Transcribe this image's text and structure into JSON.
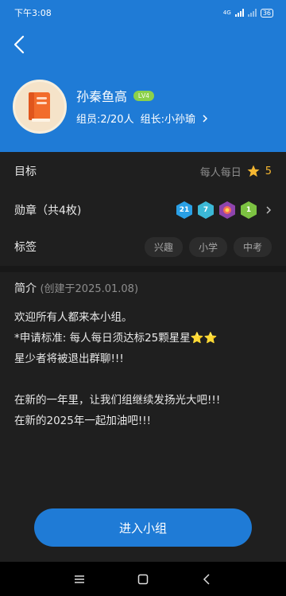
{
  "status_bar": {
    "time": "下午3:08",
    "network": "4G",
    "battery": "36"
  },
  "group": {
    "name": "孙秦鱼高",
    "level": "LV4",
    "members": "组员:2/20人",
    "leader": "组长:小孙瑜"
  },
  "goal": {
    "label": "目标",
    "value": "每人每日",
    "star_count": "5"
  },
  "medals": {
    "label": "勋章（共4枚)",
    "items": [
      {
        "text": "21",
        "color": "#2aa0e6"
      },
      {
        "text": "7",
        "color": "#3bb8d6"
      },
      {
        "text": "",
        "color": "#8e44ad"
      },
      {
        "text": "1",
        "color": "#7cc242"
      }
    ]
  },
  "tags": {
    "label": "标签",
    "items": [
      "兴趣",
      "小学",
      "中考"
    ]
  },
  "intro": {
    "title": "简介",
    "created": "(创建于2025.01.08)",
    "lines": [
      "欢迎所有人都来本小组。",
      "*申请标准: 每人每日须达标25颗星星⭐⭐",
      "星少者将被退出群聊!!!",
      "",
      "在新的一年里，让我们组继续发扬光大吧!!!",
      "在新的2025年一起加油吧!!!"
    ]
  },
  "join_button": "进入小组",
  "colors": {
    "primary": "#1f7bd6",
    "background": "#1f1f1f",
    "star": "#f5b731",
    "level_badge": "#8bd14a"
  }
}
